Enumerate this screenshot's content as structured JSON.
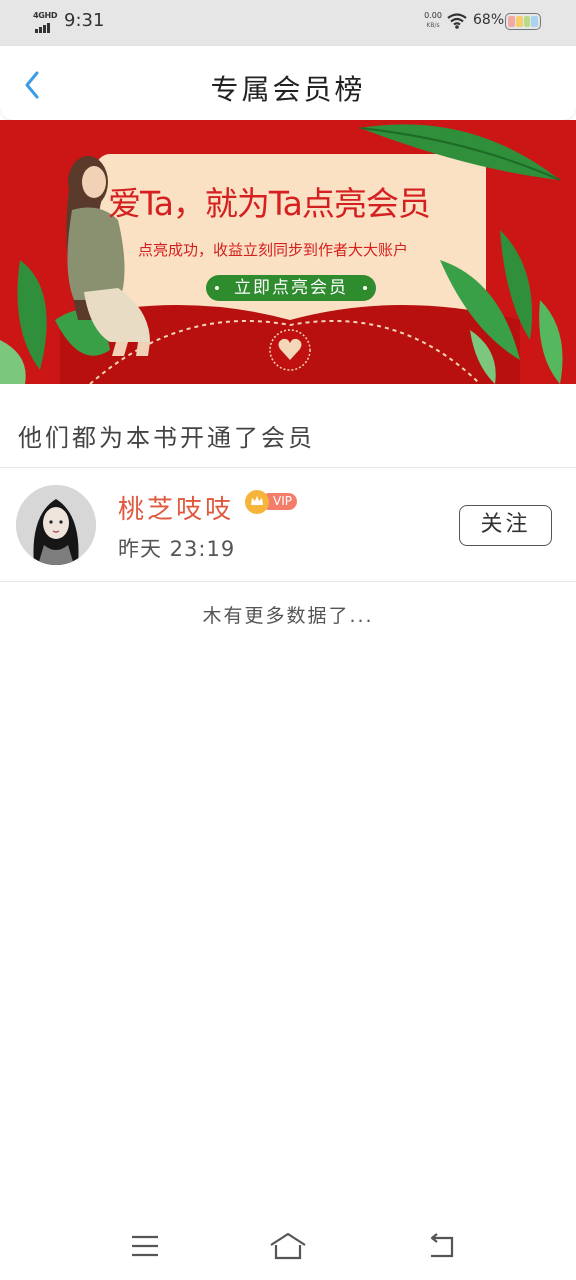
{
  "status_bar": {
    "network": "4GHD",
    "time": "9:31",
    "speed_value": "0.00",
    "speed_unit": "KB/s",
    "battery": "68%",
    "battery_colors": [
      "#f1a9a0",
      "#f5cf6b",
      "#b9dc8a",
      "#a8d4f0"
    ]
  },
  "header": {
    "title": "专属会员榜",
    "back_icon": "chevron-left-icon",
    "accent": "#3a9be6"
  },
  "banner": {
    "headline": "爱Ta，就为Ta点亮会员",
    "subline": "点亮成功，收益立刻同步到作者大大账户",
    "cta": "立即点亮会员",
    "colors": {
      "background": "#cc1616",
      "card": "#fbe1c3",
      "cta": "#2e8b2e",
      "text": "#d42020"
    }
  },
  "section": {
    "title": "他们都为本书开通了会员"
  },
  "members": [
    {
      "name": "桃芝吱吱",
      "vip": "VIP",
      "time": "昨天 23:19",
      "follow": "关注"
    }
  ],
  "list_footer": "木有更多数据了...",
  "nav": {
    "menu_icon": "menu-icon",
    "home_icon": "home-icon",
    "back_icon": "back-icon"
  }
}
